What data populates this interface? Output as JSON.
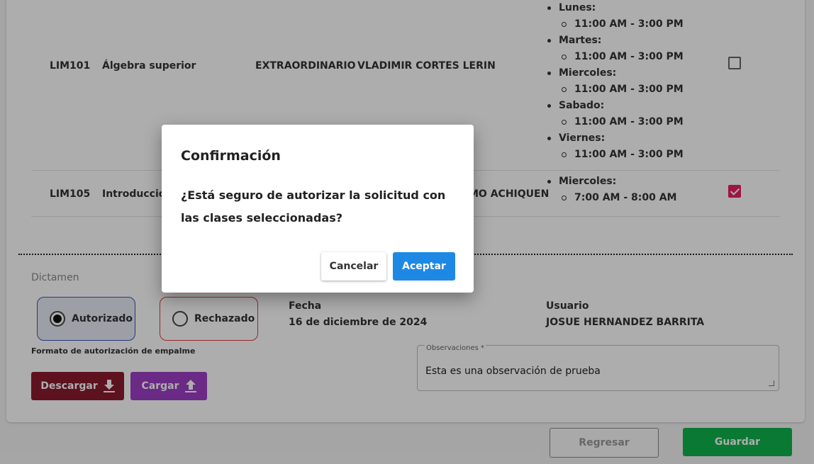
{
  "table": {
    "rows": [
      {
        "code": "LIM101",
        "name": "Álgebra superior",
        "type": "EXTRAORDINARIO",
        "professor": "VLADIMIR CORTES LERIN",
        "schedule": [
          {
            "day": "Lunes:",
            "time": "11:00 AM - 3:00 PM"
          },
          {
            "day": "Martes:",
            "time": "11:00 AM - 3:00 PM"
          },
          {
            "day": "Miercoles:",
            "time": "11:00 AM - 3:00 PM"
          },
          {
            "day": "Sabado:",
            "time": "11:00 AM - 3:00 PM"
          },
          {
            "day": "Viernes:",
            "time": "11:00 AM - 3:00 PM"
          }
        ],
        "checked": false
      },
      {
        "code": "LIM105",
        "name": "Introducción",
        "type": "",
        "professor": "MO ACHIQUEN",
        "schedule": [
          {
            "day": "Miercoles:",
            "time": "7:00 AM - 8:00 AM"
          }
        ],
        "checked": true
      }
    ]
  },
  "dictamen": {
    "label": "Dictamen",
    "option_authorized": "Autorizado",
    "option_rejected": "Rechazado",
    "selected": "Autorizado"
  },
  "fecha": {
    "label": "Fecha",
    "value": "16 de diciembre de 2024"
  },
  "usuario": {
    "label": "Usuario",
    "value": "JOSUE HERNANDEZ BARRITA"
  },
  "formato": {
    "label": "Formato de autorización de empalme",
    "download_label": "Descargar",
    "upload_label": "Cargar"
  },
  "observaciones": {
    "label": "Observaciones *",
    "value": "Esta es una observación de prueba"
  },
  "footer": {
    "back_label": "Regresar",
    "save_label": "Guardar"
  },
  "modal": {
    "title": "Confirmación",
    "message": "¿Está seguro de autorizar la solicitud con las clases seleccionadas?",
    "cancel_label": "Cancelar",
    "ok_label": "Aceptar"
  },
  "colors": {
    "authorized_border": "#3f51b5",
    "rejected_border": "#e53935",
    "checkbox_checked": "#e91e63",
    "download_button": "#8b1a2f",
    "upload_button": "#9c3fc4",
    "save_button": "#0fb34c",
    "ok_button": "#1e88e5"
  }
}
